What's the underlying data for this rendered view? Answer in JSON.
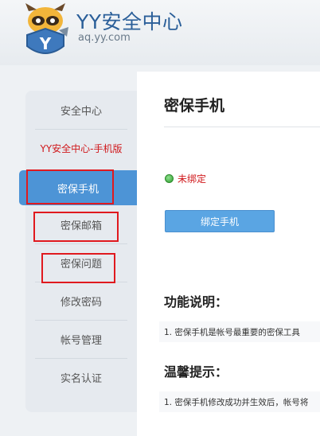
{
  "header": {
    "title": "YY安全中心",
    "url": "aq.yy.com",
    "logo_icon": "yy-raccoon-shield-logo"
  },
  "sidebar": {
    "items": [
      {
        "label": "安全中心"
      },
      {
        "label": "YY安全中心-手机版"
      },
      {
        "label": "密保手机",
        "active": true
      },
      {
        "label": "密保邮箱"
      },
      {
        "label": "密保问题"
      },
      {
        "label": "修改密码"
      },
      {
        "label": "帐号管理"
      },
      {
        "label": "实名认证"
      }
    ]
  },
  "main": {
    "title": "密保手机",
    "status": "未绑定",
    "bind_button": "绑定手机",
    "function_title": "功能说明：",
    "function_text": "1. 密保手机是帐号最重要的密保工具",
    "tips_title": "温馨提示：",
    "tips_text": "1. 密保手机修改成功并生效后，帐号将"
  },
  "colors": {
    "brand": "#2b5f99",
    "active_nav": "#4d94d6",
    "button": "#5aa5e3",
    "alert_red": "#d0181b",
    "status_green": "#2e9e2e",
    "annotation": "#e0191e"
  }
}
